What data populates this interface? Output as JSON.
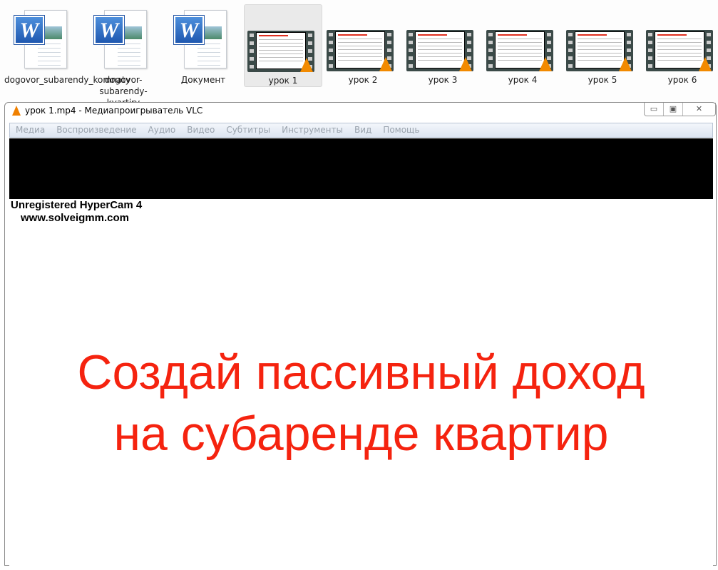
{
  "desktop": {
    "items": [
      {
        "label": "dogovor_subarendy_komnaty",
        "type": "word"
      },
      {
        "label": "dogovor-subarendy-kvartiry",
        "type": "word"
      },
      {
        "label": "Документ",
        "type": "word2007"
      },
      {
        "label": "урок 1",
        "type": "video",
        "selected": true
      },
      {
        "label": "урок 2",
        "type": "video"
      },
      {
        "label": "урок 3",
        "type": "video"
      },
      {
        "label": "урок 4",
        "type": "video"
      },
      {
        "label": "урок 5",
        "type": "video"
      },
      {
        "label": "урок 6",
        "type": "video"
      }
    ]
  },
  "window": {
    "title": "урок 1.mp4 - Медиапроигрыватель VLC",
    "menu": [
      "Медиа",
      "Воспроизведение",
      "Аудио",
      "Видео",
      "Субтитры",
      "Инструменты",
      "Вид",
      "Помощь"
    ]
  },
  "video": {
    "watermark_line1": "Unregistered HyperCam 4",
    "watermark_line2": "www.solveigmm.com",
    "headline_line1": "Создай пассивный доход",
    "headline_line2": "на субаренде квартир",
    "headline_color": "#f5230f"
  }
}
